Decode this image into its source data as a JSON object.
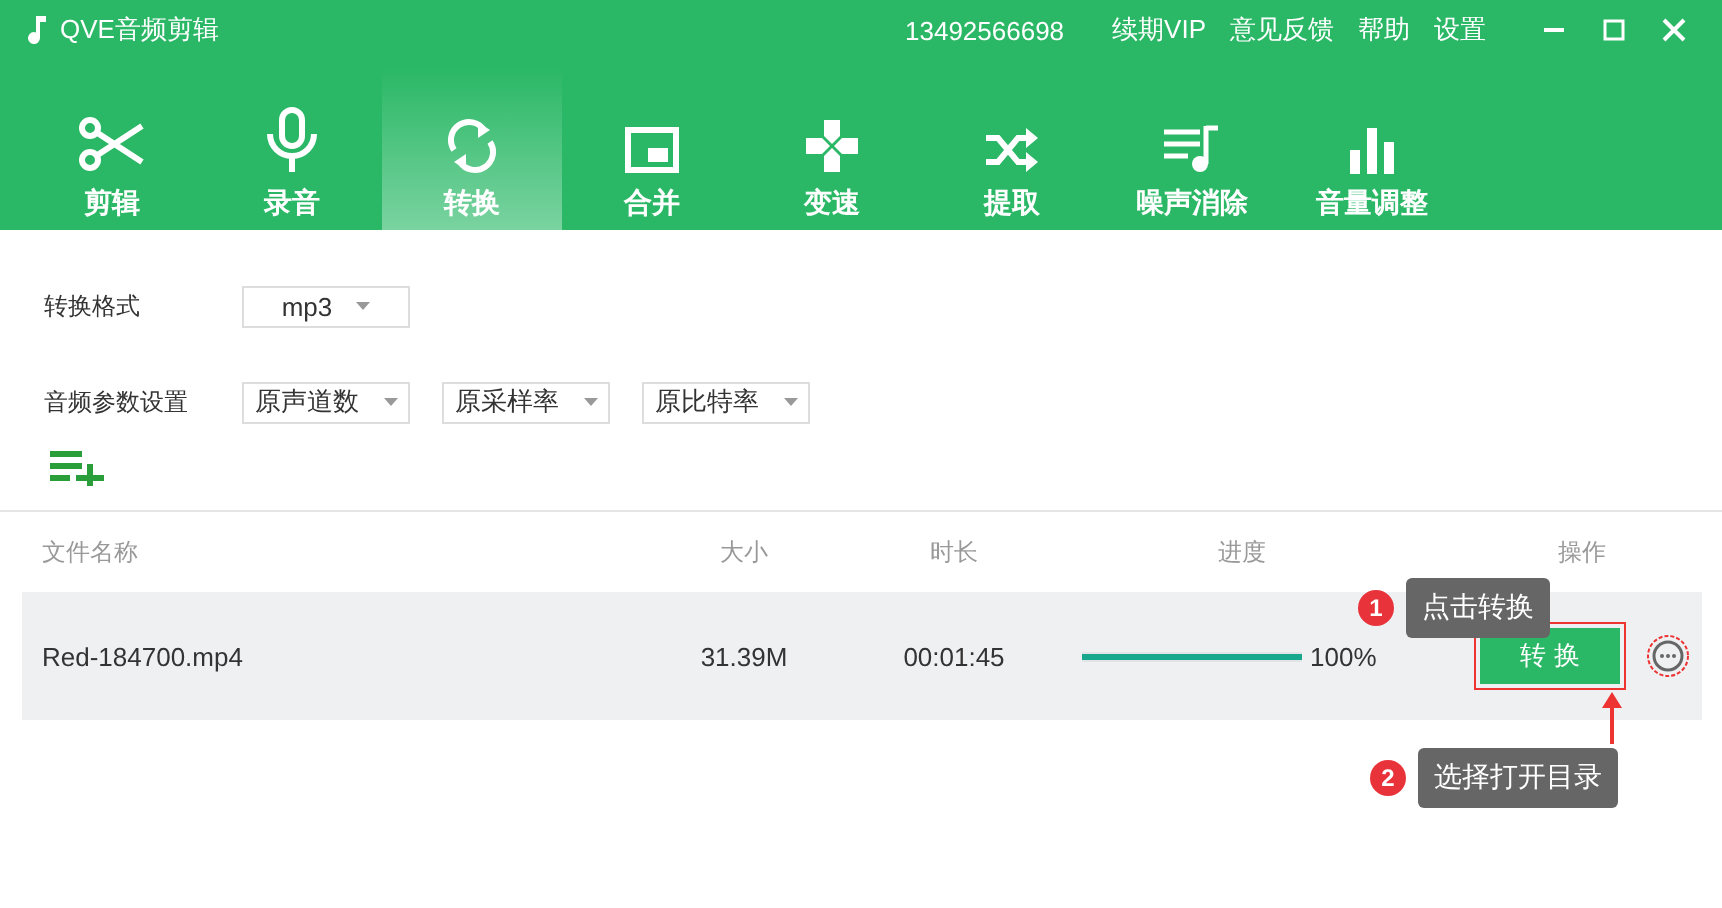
{
  "window": {
    "title": "QVE音频剪辑",
    "account": "13492566698",
    "links": [
      "续期VIP",
      "意见反馈",
      "帮助",
      "设置"
    ]
  },
  "tabs": [
    {
      "label": "剪辑",
      "kind": "scissors",
      "selected": false
    },
    {
      "label": "录音",
      "kind": "mic",
      "selected": false
    },
    {
      "label": "转换",
      "kind": "convert",
      "selected": true
    },
    {
      "label": "合并",
      "kind": "merge",
      "selected": false
    },
    {
      "label": "变速",
      "kind": "speed",
      "selected": false
    },
    {
      "label": "提取",
      "kind": "shuffle",
      "selected": false
    },
    {
      "label": "噪声消除",
      "kind": "noise",
      "selected": false
    },
    {
      "label": "音量调整",
      "kind": "volume",
      "selected": false
    }
  ],
  "format": {
    "label": "转换格式",
    "value": "mp3"
  },
  "audio_params": {
    "label": "音频参数设置",
    "values": [
      "原声道数",
      "原采样率",
      "原比特率"
    ]
  },
  "table": {
    "columns": [
      "文件名称",
      "大小",
      "时长",
      "进度",
      "操作"
    ],
    "rows": [
      {
        "name": "Red-184700.mp4",
        "size": "31.39M",
        "duration": "00:01:45",
        "level": 1,
        "progress": "100%",
        "action": "转 换"
      }
    ]
  },
  "annotations": [
    {
      "number": "1",
      "text": "点击转换"
    },
    {
      "number": "2",
      "text": "选择打开目录"
    }
  ]
}
